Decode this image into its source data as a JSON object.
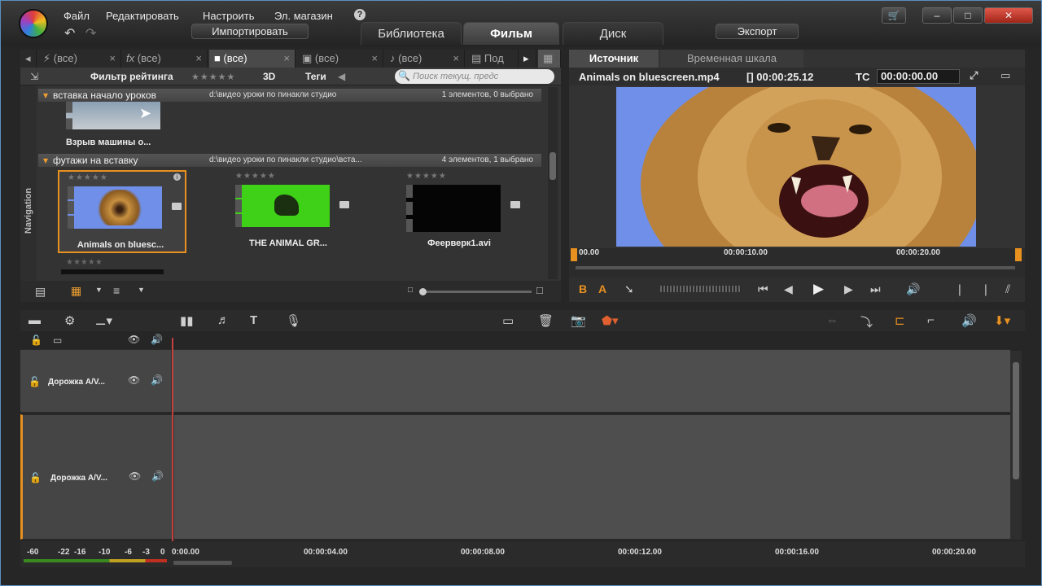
{
  "menu": {
    "file": "Файл",
    "edit": "Редактировать",
    "settings": "Настроить",
    "store": "Эл. магазин",
    "help": "?"
  },
  "toolbar": {
    "import": "Импортировать",
    "export": "Экспорт"
  },
  "main_tabs": {
    "library": "Библиотека",
    "film": "Фильм",
    "disc": "Диск"
  },
  "library": {
    "tabs": [
      "(все)",
      "(все)",
      "(все)",
      "(все)",
      "(все)",
      "Под"
    ],
    "filter_label": "Фильтр рейтинга",
    "stars": "★★★★★",
    "three_d": "3D",
    "tags": "Теги",
    "search_placeholder": "Поиск текущ. предс",
    "navigation": "Navigation",
    "group1": {
      "title": "вставка начало уроков",
      "path": "d:\\видео уроки по пинакли студио",
      "count": "1 элементов, 0 выбрано",
      "clip": "Взрыв машины о..."
    },
    "group2": {
      "title": "футажи на вставку",
      "path": "d:\\видео уроки по пинакли студио\\вста...",
      "count": "4 элементов, 1 выбрано",
      "clips": [
        "Animals on bluesc...",
        "THE ANIMAL GR...",
        "Феерверк1.avi"
      ]
    }
  },
  "preview": {
    "tab_source": "Источник",
    "tab_timeline": "Временная шкала",
    "filename": "Animals on bluescreen.mp4",
    "duration": "[] 00:00:25.12",
    "tc_label": "TC",
    "tc_value": "00:00:00.00",
    "ruler": [
      "00.00",
      "00:00:10.00",
      "00:00:20.00"
    ],
    "mark_b": "B",
    "mark_a": "A"
  },
  "timeline": {
    "tracks": [
      "Дорожка A/V...",
      "Дорожка A/V..."
    ],
    "ruler": [
      "0:00.00",
      "00:00:04.00",
      "00:00:08.00",
      "00:00:12.00",
      "00:00:16.00",
      "00:00:20.00"
    ],
    "meter": [
      "-60",
      "-22",
      "-16",
      "-10",
      "-6",
      "-3",
      "0"
    ],
    "title_tool": "T"
  },
  "colors": {
    "accent": "#e89020",
    "playhead": "#c04040",
    "bluescreen": "#6f8fe8",
    "greenscreen": "#3fd018"
  }
}
